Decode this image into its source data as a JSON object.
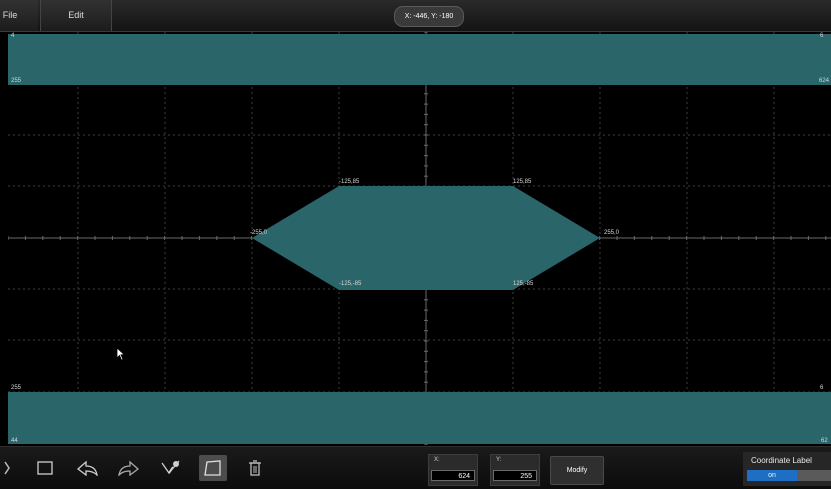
{
  "menu": {
    "file_label": "File",
    "edit_label": "Edit"
  },
  "cursor_readout": "X: -446, Y: -180",
  "plot": {
    "colors": {
      "fill": "#2a6569",
      "grid": "#3f3f3f",
      "axis": "#6a6a6a",
      "background": "#000000"
    },
    "mask_top_labels": {
      "left_top": "4",
      "left_bottom": "255",
      "right_top": "6",
      "right_bottom": "624"
    },
    "mask_bottom_labels": {
      "left_top": "255",
      "left_bottom": "44",
      "right_top": "6",
      "right_bottom": "62"
    },
    "vertex_labels": {
      "top_left": "-125,85",
      "top_right": "125,85",
      "left": "-255,0",
      "right": "255,0",
      "bottom_left": "-125,-85",
      "bottom_right": "125,-85"
    }
  },
  "toolbar": {
    "icons": [
      "unknown-icon",
      "rectangle-icon",
      "undo-icon",
      "redo-icon",
      "edit-points-icon",
      "polygon-icon",
      "trash-icon"
    ],
    "x_label": "X:",
    "x_value": "624",
    "y_label": "Y:",
    "y_value": "255",
    "modify_label": "Modify",
    "coordinate_label_title": "Coordinate Label",
    "coordinate_label_state": "on"
  }
}
